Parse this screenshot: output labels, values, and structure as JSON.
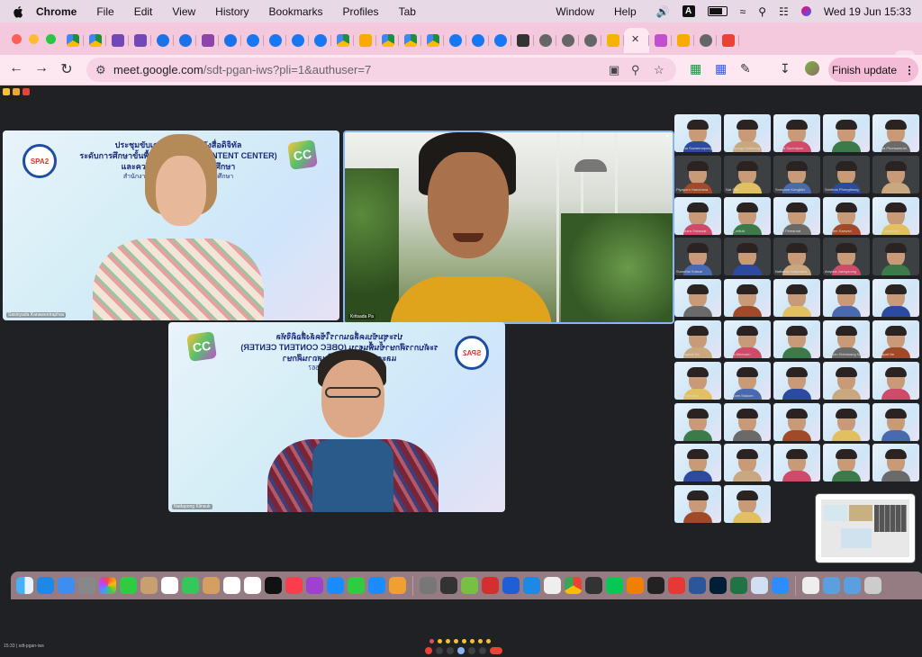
{
  "menubar": {
    "app_name": "Chrome",
    "menus": [
      "File",
      "Edit",
      "View",
      "History",
      "Bookmarks",
      "Profiles",
      "Tab"
    ],
    "right_menus": [
      "Window",
      "Help"
    ],
    "input_source": "A",
    "datetime": "Wed 19 Jun  15:33"
  },
  "browser": {
    "url_host": "meet.google.com",
    "url_path": "/sdt-pgan-iws?pli=1&authuser=7",
    "finish_update_label": "Finish update",
    "tab_favicons": [
      "drive",
      "drive",
      "forms",
      "forms",
      "meet-c",
      "meet-c",
      "badge",
      "meet-c",
      "facebook",
      "facebook",
      "facebook",
      "facebook",
      "drive",
      "classroom",
      "drive",
      "drive",
      "drive",
      "facebook",
      "facebook",
      "facebook",
      "download",
      "globe",
      "globe",
      "globe",
      "slides",
      "meet-active",
      "games",
      "classroom",
      "globe",
      "gmail"
    ],
    "active_tab_index": 25
  },
  "meet": {
    "main_tiles": [
      {
        "label": "Sasinyada Kanaweetraphas",
        "banner_line1": "ประชุมขับเคลื่อนการใช้คลังสื่อดิจิทัล",
        "banner_line2": "ระดับการศึกษาขั้นพื้นฐาน (OBEC CONTENT CENTER)",
        "banner_line3": "และความปลอดภัยในสถานศึกษา",
        "banner_line4": "สำนักงานเขตพื้นที่การศึกษาประถมศึกษา"
      },
      {
        "label": "Kritsada Pa"
      },
      {
        "label": "Nattapong Klinsuk",
        "banner_line1": "ประชุมขับเคลื่อนการใช้คลังสื่อดิจิทัล",
        "banner_line2": "ระดับการศึกษาขั้นพื้นฐาน (OBEC CONTENT CENTER)",
        "banner_line3": "และความปลอดภัยในสถานศึกษา",
        "banner_line4": "วันที่ 19 มิถุนายน 2567"
      }
    ],
    "logo_text": "SPA2",
    "cc_logo_text": "CC",
    "grid_names": [
      "Jintana Suwannapong",
      "Sutthipong Chaiwong",
      "Kitima Suchatjam",
      "",
      "Sunisa Phonsamran",
      "Piyaporn Hanchana",
      "Nat Sae",
      "Somporn Kongklin",
      "Srinthon Phongthong",
      "",
      "Watchara Srisawat",
      "noey_wifcld",
      "Pimpi Pineanrat",
      "Jarunee Kaewsri",
      "SDL Classroom",
      "Surachai Suksai",
      "",
      "Nattakan Kaeprasut",
      "Ampika Jaengsomg",
      "",
      "",
      "",
      "",
      "",
      "",
      "Chanaphat Ka",
      "Pattra Meeruen",
      "",
      "Jiraporn Hoimluang Nawin",
      "Jakkapat Ne",
      "Tiwa Kaewkla",
      "Sataporn Makom",
      "",
      "",
      "",
      "",
      "",
      "",
      "",
      "",
      "",
      "",
      "",
      "",
      "",
      "",
      "",
      "",
      ""
    ],
    "meeting_code_info": "15:33  |  sdt-pgan-iws"
  },
  "colors": {
    "menubar_bg": "#e8d9e6",
    "tabstrip_bg": "#f5c9dd",
    "toolbar_bg": "#fde8f1",
    "meet_bg": "#202124",
    "end_call": "#ea4335"
  }
}
